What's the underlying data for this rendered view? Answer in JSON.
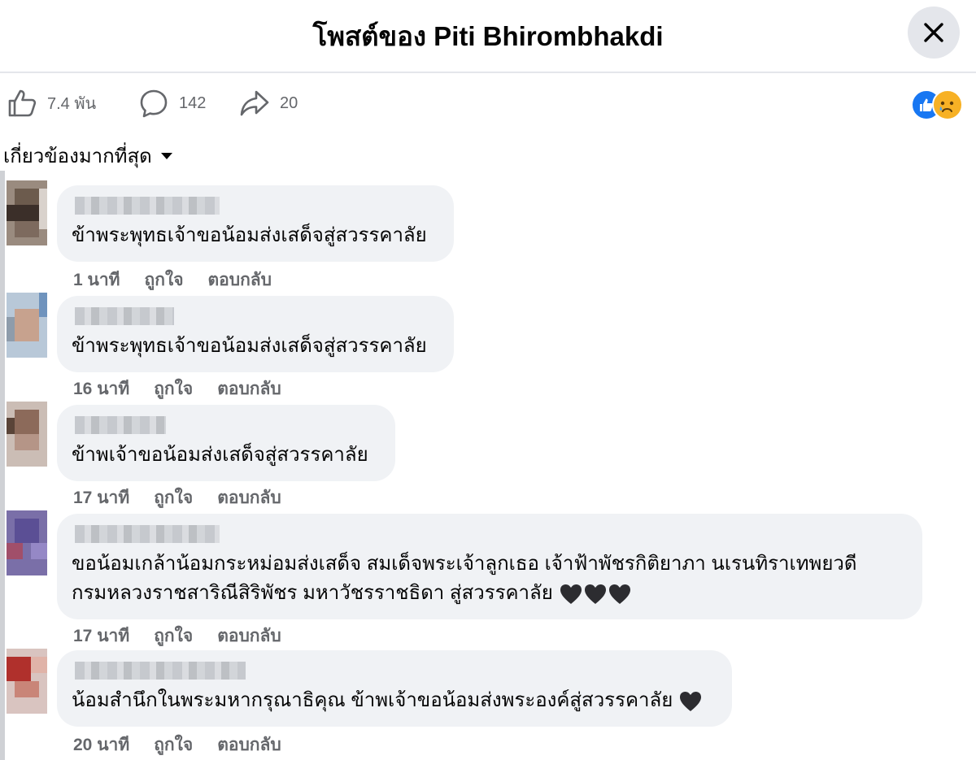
{
  "header": {
    "title": "โพสต์ของ Piti Bhirombhakdi"
  },
  "actions": {
    "likes": "7.4 พัน",
    "comments": "142",
    "shares": "20"
  },
  "reactions": [
    "like-reaction",
    "sad-reaction"
  ],
  "sort": {
    "label": "เกี่ยวข้องมากที่สุด"
  },
  "comments": [
    {
      "text": "ข้าพระพุทธเจ้าขอน้อมส่งเสด็จสู่สวรรคาลัย",
      "time": "1 นาที",
      "like": "ถูกใจ",
      "reply": "ตอบกลับ"
    },
    {
      "text": "ข้าพระพุทธเจ้าขอน้อมส่งเสด็จสู่สวรรคาลัย",
      "time": "16 นาที",
      "like": "ถูกใจ",
      "reply": "ตอบกลับ"
    },
    {
      "text": "ข้าพเจ้าขอน้อมส่งเสด็จสู่สวรรคาลัย",
      "time": "17 นาที",
      "like": "ถูกใจ",
      "reply": "ตอบกลับ"
    },
    {
      "text_line1": "ขอน้อมเกล้าน้อมกระหม่อมส่งเสด็จ สมเด็จพระเจ้าลูกเธอ เจ้าฟ้าพัชรกิติยาภา นเรนทิราเทพยวดี",
      "text_line2": "กรมหลวงราชสาริณีสิริพัชร มหาวัชรราชธิดา สู่สวรรคาลัย",
      "time": "17 นาที",
      "like": "ถูกใจ",
      "reply": "ตอบกลับ"
    },
    {
      "text": "น้อมสำนึกในพระมหากรุณาธิคุณ ข้าพเจ้าขอน้อมส่งพระองค์สู่สวรรคาลัย",
      "time": "20 นาที",
      "like": "ถูกใจ",
      "reply": "ตอบกลับ"
    }
  ],
  "colors": {
    "bubble": "#f0f2f5",
    "meta": "#65676b",
    "like_blue": "#1877f2",
    "sad_yellow": "#f7b125",
    "heart": "#2c2c30"
  }
}
